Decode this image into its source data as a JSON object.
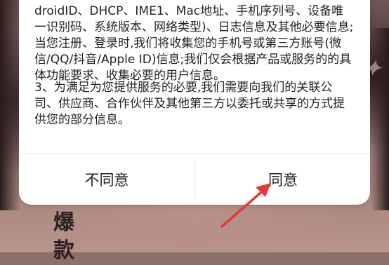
{
  "background": {
    "caption_text": "爆款"
  },
  "dialog": {
    "paragraph1": "号(为其服务安全及保证服务稳定,我们需要收集设备信息(AndroidID、DHCP、IME1、Mac地址、手机序列号、设备唯一识别码、系统版本、网络类型)、日志信息及其他必要信息;当您注册、登录时,我们将收集您的手机号或第三方账号(微信/QQ/抖音/Apple ID)信息;我们仅会根据产品或服务的的具体功能要求、收集必要的用户信息。",
    "paragraph2": "3、为满足为您提供服务的必要,我们需要向我们的关联公司、供应商、合作伙伴及其他第三方以委托或共享的方式提供您的部分信息。",
    "disagree_label": "不同意",
    "agree_label": "同意"
  },
  "annotation": {
    "arrow_color": "#e53935"
  }
}
